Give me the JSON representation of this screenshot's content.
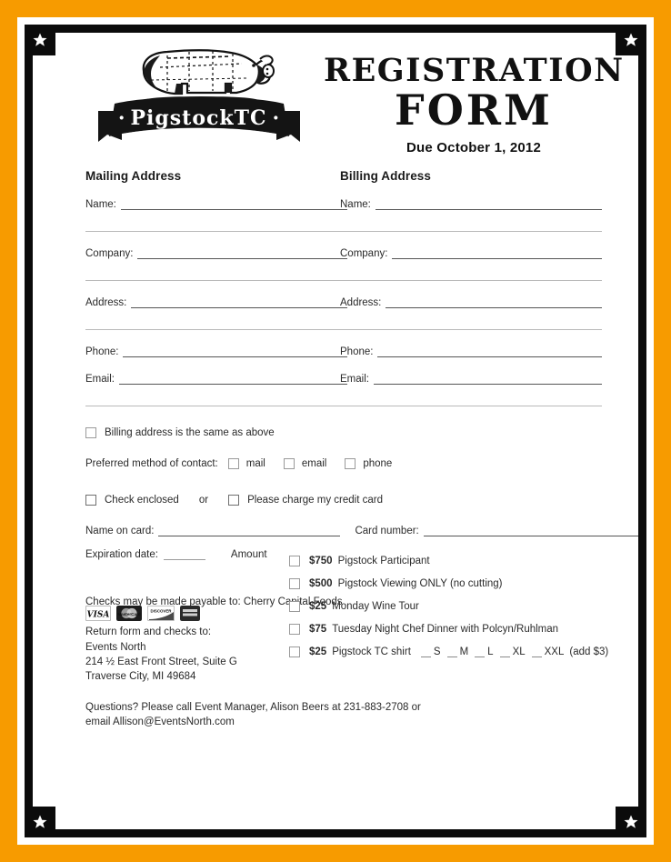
{
  "page": {
    "border_color": "#f79b00",
    "frame_color": "#0b0b0b",
    "star_icon": "star-icon"
  },
  "header": {
    "logo": {
      "banner_text": "PigstockTC",
      "banner_dot_left": "·",
      "banner_dot_right": "·",
      "pig_alt": "pig-butcher-chart"
    },
    "title_line1": "REGISTRATION",
    "title_line2": "FORM",
    "due_date": "Due October 1, 2012"
  },
  "mailing": {
    "heading": "Mailing Address",
    "fields": [
      {
        "label": "Name:"
      },
      {
        "label": "Company:"
      },
      {
        "label": "Address:"
      },
      {
        "label": "Phone:"
      },
      {
        "label": "Email:"
      }
    ]
  },
  "billing": {
    "heading": "Billing Address",
    "fields": [
      {
        "label": "Name:"
      },
      {
        "label": "Company:"
      },
      {
        "label": "Address:"
      },
      {
        "label": "Phone:"
      },
      {
        "label": "Email:"
      }
    ]
  },
  "options": {
    "same_as_above": "Billing address is the same as above",
    "preferred_label": "Preferred method of contact:",
    "preferred_choices": [
      "mail",
      "email",
      "phone"
    ],
    "check_enclosed": "Check enclosed",
    "or_word": "or",
    "charge_card": "Please charge my credit card"
  },
  "payment": {
    "name_on_card_label": "Name on card:",
    "card_number_label": "Card number:",
    "expiration_label": "Expiration date:",
    "amount_label": "Amount",
    "card_logos": [
      "VISA",
      "MasterCard",
      "DISCOVER",
      "AMEX"
    ]
  },
  "prices": [
    {
      "amount": "$750",
      "desc": "Pigstock Participant"
    },
    {
      "amount": "$500",
      "desc": "Pigstock Viewing ONLY (no cutting)"
    },
    {
      "amount": "$25",
      "desc": "Monday Wine Tour"
    },
    {
      "amount": "$75",
      "desc": "Tuesday Night Chef Dinner with Polcyn/Ruhlman"
    },
    {
      "amount": "$25",
      "desc": "Pigstock TC shirt",
      "sizes": [
        "S",
        "M",
        "L",
        "XL",
        "XXL"
      ],
      "size_note": "(add $3)"
    }
  ],
  "footer": {
    "checks_payable": "Checks may be made payable to: Cherry Capital Foods",
    "return_intro": "Return form and checks to:",
    "return_org": "Events North",
    "return_street": "214 ½ East Front Street, Suite G",
    "return_city": "Traverse City, MI 49684",
    "questions_line1": "Questions? Please call Event Manager, Alison Beers at 231-883-2708 or",
    "questions_line2": "email Allison@EventsNorth.com"
  }
}
